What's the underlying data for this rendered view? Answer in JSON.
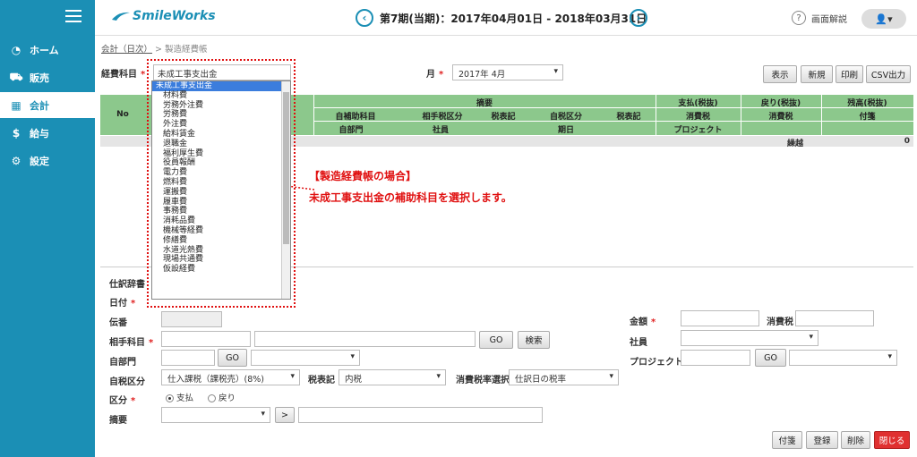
{
  "sidebar": {
    "items": [
      {
        "label": "ホーム",
        "icon": "dashboard-icon"
      },
      {
        "label": "販売",
        "icon": "cart-icon"
      },
      {
        "label": "会計",
        "icon": "calculator-icon"
      },
      {
        "label": "給与",
        "icon": "money-bag-icon"
      },
      {
        "label": "設定",
        "icon": "gear-icon"
      }
    ],
    "active_index": 2
  },
  "header": {
    "logo": "SmileWorks",
    "period": "第7期(当期)：2017年04月01日 - 2018年03月31日",
    "prev": "‹",
    "next": "›",
    "help_label": "画面解説",
    "help_icon": "?",
    "user_icon": "👤▾"
  },
  "breadcrumb": {
    "parent": "会計（日次）",
    "sep": ">",
    "current": "製造経費帳"
  },
  "filters": {
    "account_label": "経費科目",
    "account_value": "未成工事支出金",
    "month_label": "月",
    "month_value": "2017年 4月",
    "required_mark": "*"
  },
  "toolbar": {
    "display": "表示",
    "new": "新規",
    "print": "印刷",
    "csv": "CSV出力"
  },
  "table": {
    "no": "No",
    "summary": "摘要",
    "sub_account": "自補助科目",
    "partner_class": "相手税区分",
    "tax_mark1": "税表記",
    "own_class": "自税区分",
    "tax_mark2": "税表記",
    "own_dept": "自部門",
    "employee": "社員",
    "due_date": "期日",
    "payment": "支払(税抜)",
    "tax1": "消費税",
    "project": "プロジェクト",
    "refund": "戻り(税抜)",
    "tax2": "消費税",
    "balance": "残高(税抜)",
    "memo": "付箋",
    "carry_label": "繰越",
    "carry_value": "0"
  },
  "dropdown": {
    "items": [
      "未成工事支出金",
      "材料費",
      "労務外注費",
      "労務費",
      "外注費",
      "給料賃金",
      "退職金",
      "福利厚生費",
      "役員報酬",
      "電力費",
      "燃料費",
      "運搬費",
      "履車費",
      "事務費",
      "消耗品費",
      "機械等経費",
      "修繕費",
      "水道光熱費",
      "現場共通費",
      "仮設経費"
    ],
    "selected_index": 0
  },
  "annotation": {
    "title": "【製造経費帳の場合】",
    "body": "未成工事支出金の補助科目を選択します。"
  },
  "form": {
    "journal_dict": "仕訳辞書",
    "date": "日付",
    "voucher": "伝番",
    "partner_account": "相手科目",
    "go": "GO",
    "search": "検索",
    "own_dept": "自部門",
    "own_tax_class": "自税区分",
    "own_tax_class_value": "仕入課税（課税売）(8%)",
    "tax_mark": "税表記",
    "tax_mark_value": "内税",
    "tax_rate_select": "消費税率選択",
    "tax_rate_value": "仕訳日の税率",
    "kubun": "区分",
    "kubun_opt1": "支払",
    "kubun_opt2": "戻り",
    "summary": "摘要",
    "summary_btn": ">",
    "amount": "金額",
    "consumption_tax": "消費税",
    "employee": "社員",
    "project": "プロジェクト",
    "required_mark": "*"
  },
  "footer": {
    "memo": "付箋",
    "register": "登録",
    "delete": "削除",
    "close": "閉じる"
  }
}
